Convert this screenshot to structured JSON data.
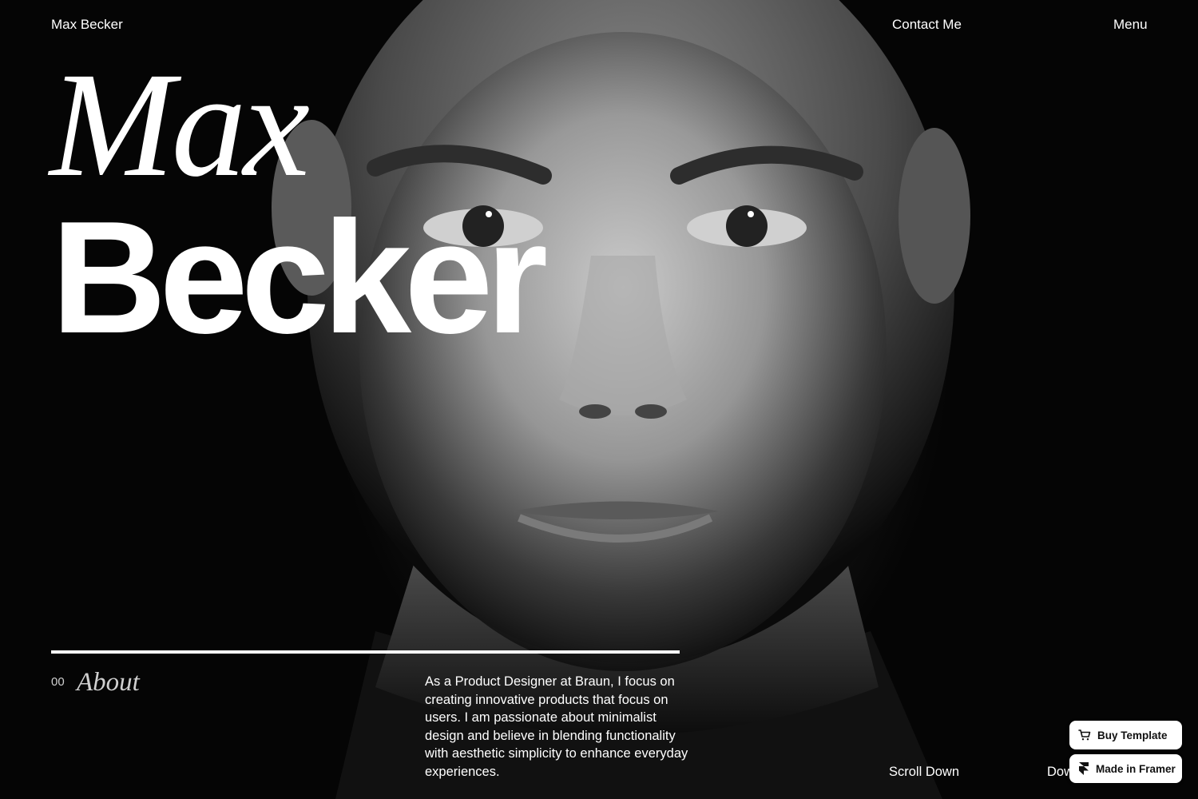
{
  "header": {
    "brand": "Max Becker",
    "contact_label": "Contact Me",
    "menu_label": "Menu"
  },
  "hero": {
    "first_name": "Max",
    "last_name": "Becker"
  },
  "about": {
    "number": "00",
    "label": "About",
    "text": "As a Product Designer at Braun, I focus on creating innovative products that focus on users. I am passionate about minimalist design and believe in blending functionality with aesthetic simplicity to enhance everyday experiences."
  },
  "scroll": {
    "label_1": "Scroll Down",
    "label_2": "Down"
  },
  "badges": {
    "buy_label": "Buy Template",
    "framer_label": "Made in Framer"
  },
  "colors": {
    "background": "#000000",
    "text": "#ffffff",
    "badge_bg": "#ffffff",
    "badge_text": "#111111"
  },
  "icons": {
    "buy": "cart-icon",
    "framer": "framer-logo-icon"
  }
}
